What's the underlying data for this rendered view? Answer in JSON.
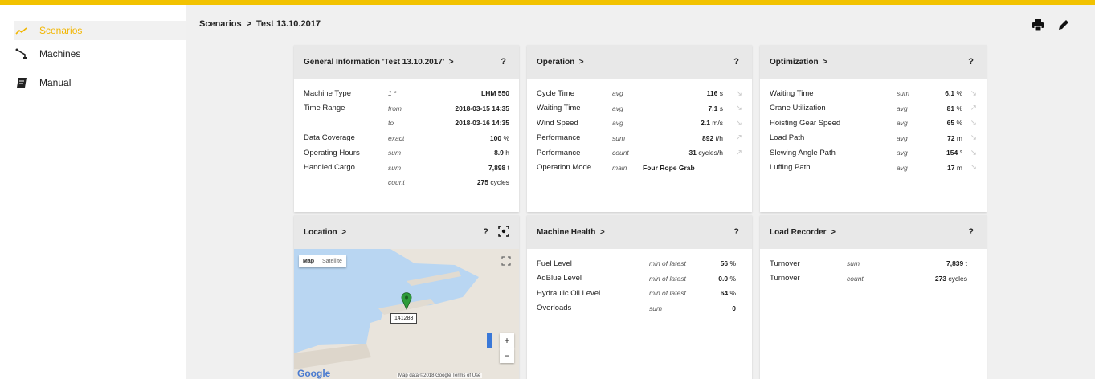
{
  "sidebar": {
    "items": [
      {
        "label": "Scenarios",
        "icon": "trending-up-icon",
        "active": true
      },
      {
        "label": "Machines",
        "icon": "crane-icon",
        "active": false
      },
      {
        "label": "Manual",
        "icon": "book-icon",
        "active": false
      }
    ]
  },
  "breadcrumb": {
    "root": "Scenarios",
    "sep": ">",
    "current": "Test 13.10.2017"
  },
  "toolbar": {
    "print_icon": "print-icon",
    "edit_icon": "edit-icon"
  },
  "colors": {
    "accent": "#f2c200",
    "active_text": "#f2b600",
    "panel_head": "#e8e8e8",
    "map_water": "#b9d6f2",
    "map_land": "#e9e4dc",
    "pin": "#2e9c3a"
  },
  "cards": {
    "general": {
      "title": "General Information 'Test 13.10.2017'",
      "chev": ">",
      "help": "?",
      "rows": [
        {
          "label": "Machine Type",
          "agg": "1 *",
          "value": "LHM 550",
          "unit": ""
        },
        {
          "label": "Time Range",
          "agg": "from",
          "value": "2018-03-15 14:35",
          "unit": ""
        },
        {
          "label": "",
          "agg": "to",
          "value": "2018-03-16 14:35",
          "unit": ""
        },
        {
          "label": "Data Coverage",
          "agg": "exact",
          "value": "100",
          "unit": " %"
        },
        {
          "label": "Operating Hours",
          "agg": "sum",
          "value": "8.9",
          "unit": " h"
        },
        {
          "label": "Handled Cargo",
          "agg": "sum",
          "value": "7,898",
          "unit": " t"
        },
        {
          "label": "",
          "agg": "count",
          "value": "275",
          "unit": " cycles"
        }
      ]
    },
    "operation": {
      "title": "Operation",
      "chev": ">",
      "help": "?",
      "rows": [
        {
          "label": "Cycle Time",
          "agg": "avg",
          "value": "116",
          "unit": " s",
          "arrow": "↘"
        },
        {
          "label": "Waiting Time",
          "agg": "avg",
          "value": "7.1",
          "unit": " s",
          "arrow": "↘"
        },
        {
          "label": "Wind Speed",
          "agg": "avg",
          "value": "2.1",
          "unit": " m/s",
          "arrow": "↘"
        },
        {
          "label": "Performance",
          "agg": "sum",
          "value": "892",
          "unit": " t/h",
          "arrow": "↗"
        },
        {
          "label": "Performance",
          "agg": "count",
          "value": "31",
          "unit": " cycles/h",
          "arrow": "↗"
        },
        {
          "label": "Operation Mode",
          "agg": "main",
          "value": "Four Rope Grab",
          "unit": "",
          "arrow": ""
        }
      ]
    },
    "optimization": {
      "title": "Optimization",
      "chev": ">",
      "help": "?",
      "rows": [
        {
          "label": "Waiting Time",
          "agg": "sum",
          "value": "6.1",
          "unit": " %",
          "arrow": "↘"
        },
        {
          "label": "Crane Utilization",
          "agg": "avg",
          "value": "81",
          "unit": " %",
          "arrow": "↗"
        },
        {
          "label": "Hoisting Gear Speed",
          "agg": "avg",
          "value": "65",
          "unit": " %",
          "arrow": "↘"
        },
        {
          "label": "Load Path",
          "agg": "avg",
          "value": "72",
          "unit": " m",
          "arrow": "↘"
        },
        {
          "label": "Slewing Angle Path",
          "agg": "avg",
          "value": "154",
          "unit": " °",
          "arrow": "↘"
        },
        {
          "label": "Luffing Path",
          "agg": "avg",
          "value": "17",
          "unit": " m",
          "arrow": "↘"
        }
      ]
    },
    "location": {
      "title": "Location",
      "chev": ">",
      "help": "?",
      "map_tab": "Map",
      "satellite_tab": "Satellite",
      "pin_label": "141283",
      "zoom_in": "+",
      "zoom_out": "−",
      "google": "Google",
      "attribution": "Map data ©2018 Google   Terms of Use"
    },
    "health": {
      "title": "Machine Health",
      "chev": ">",
      "help": "?",
      "rows": [
        {
          "label": "Fuel Level",
          "agg": "min of latest",
          "value": "56",
          "unit": " %"
        },
        {
          "label": "AdBlue Level",
          "agg": "min of latest",
          "value": "0.0",
          "unit": " %"
        },
        {
          "label": "Hydraulic Oil Level",
          "agg": "min of latest",
          "value": "64",
          "unit": " %"
        },
        {
          "label": "Overloads",
          "agg": "sum",
          "value": "0",
          "unit": ""
        }
      ]
    },
    "recorder": {
      "title": "Load Recorder",
      "chev": ">",
      "help": "?",
      "rows": [
        {
          "label": "Turnover",
          "agg": "sum",
          "value": "7,839",
          "unit": " t"
        },
        {
          "label": "Turnover",
          "agg": "count",
          "value": "273",
          "unit": " cycles"
        }
      ]
    }
  }
}
